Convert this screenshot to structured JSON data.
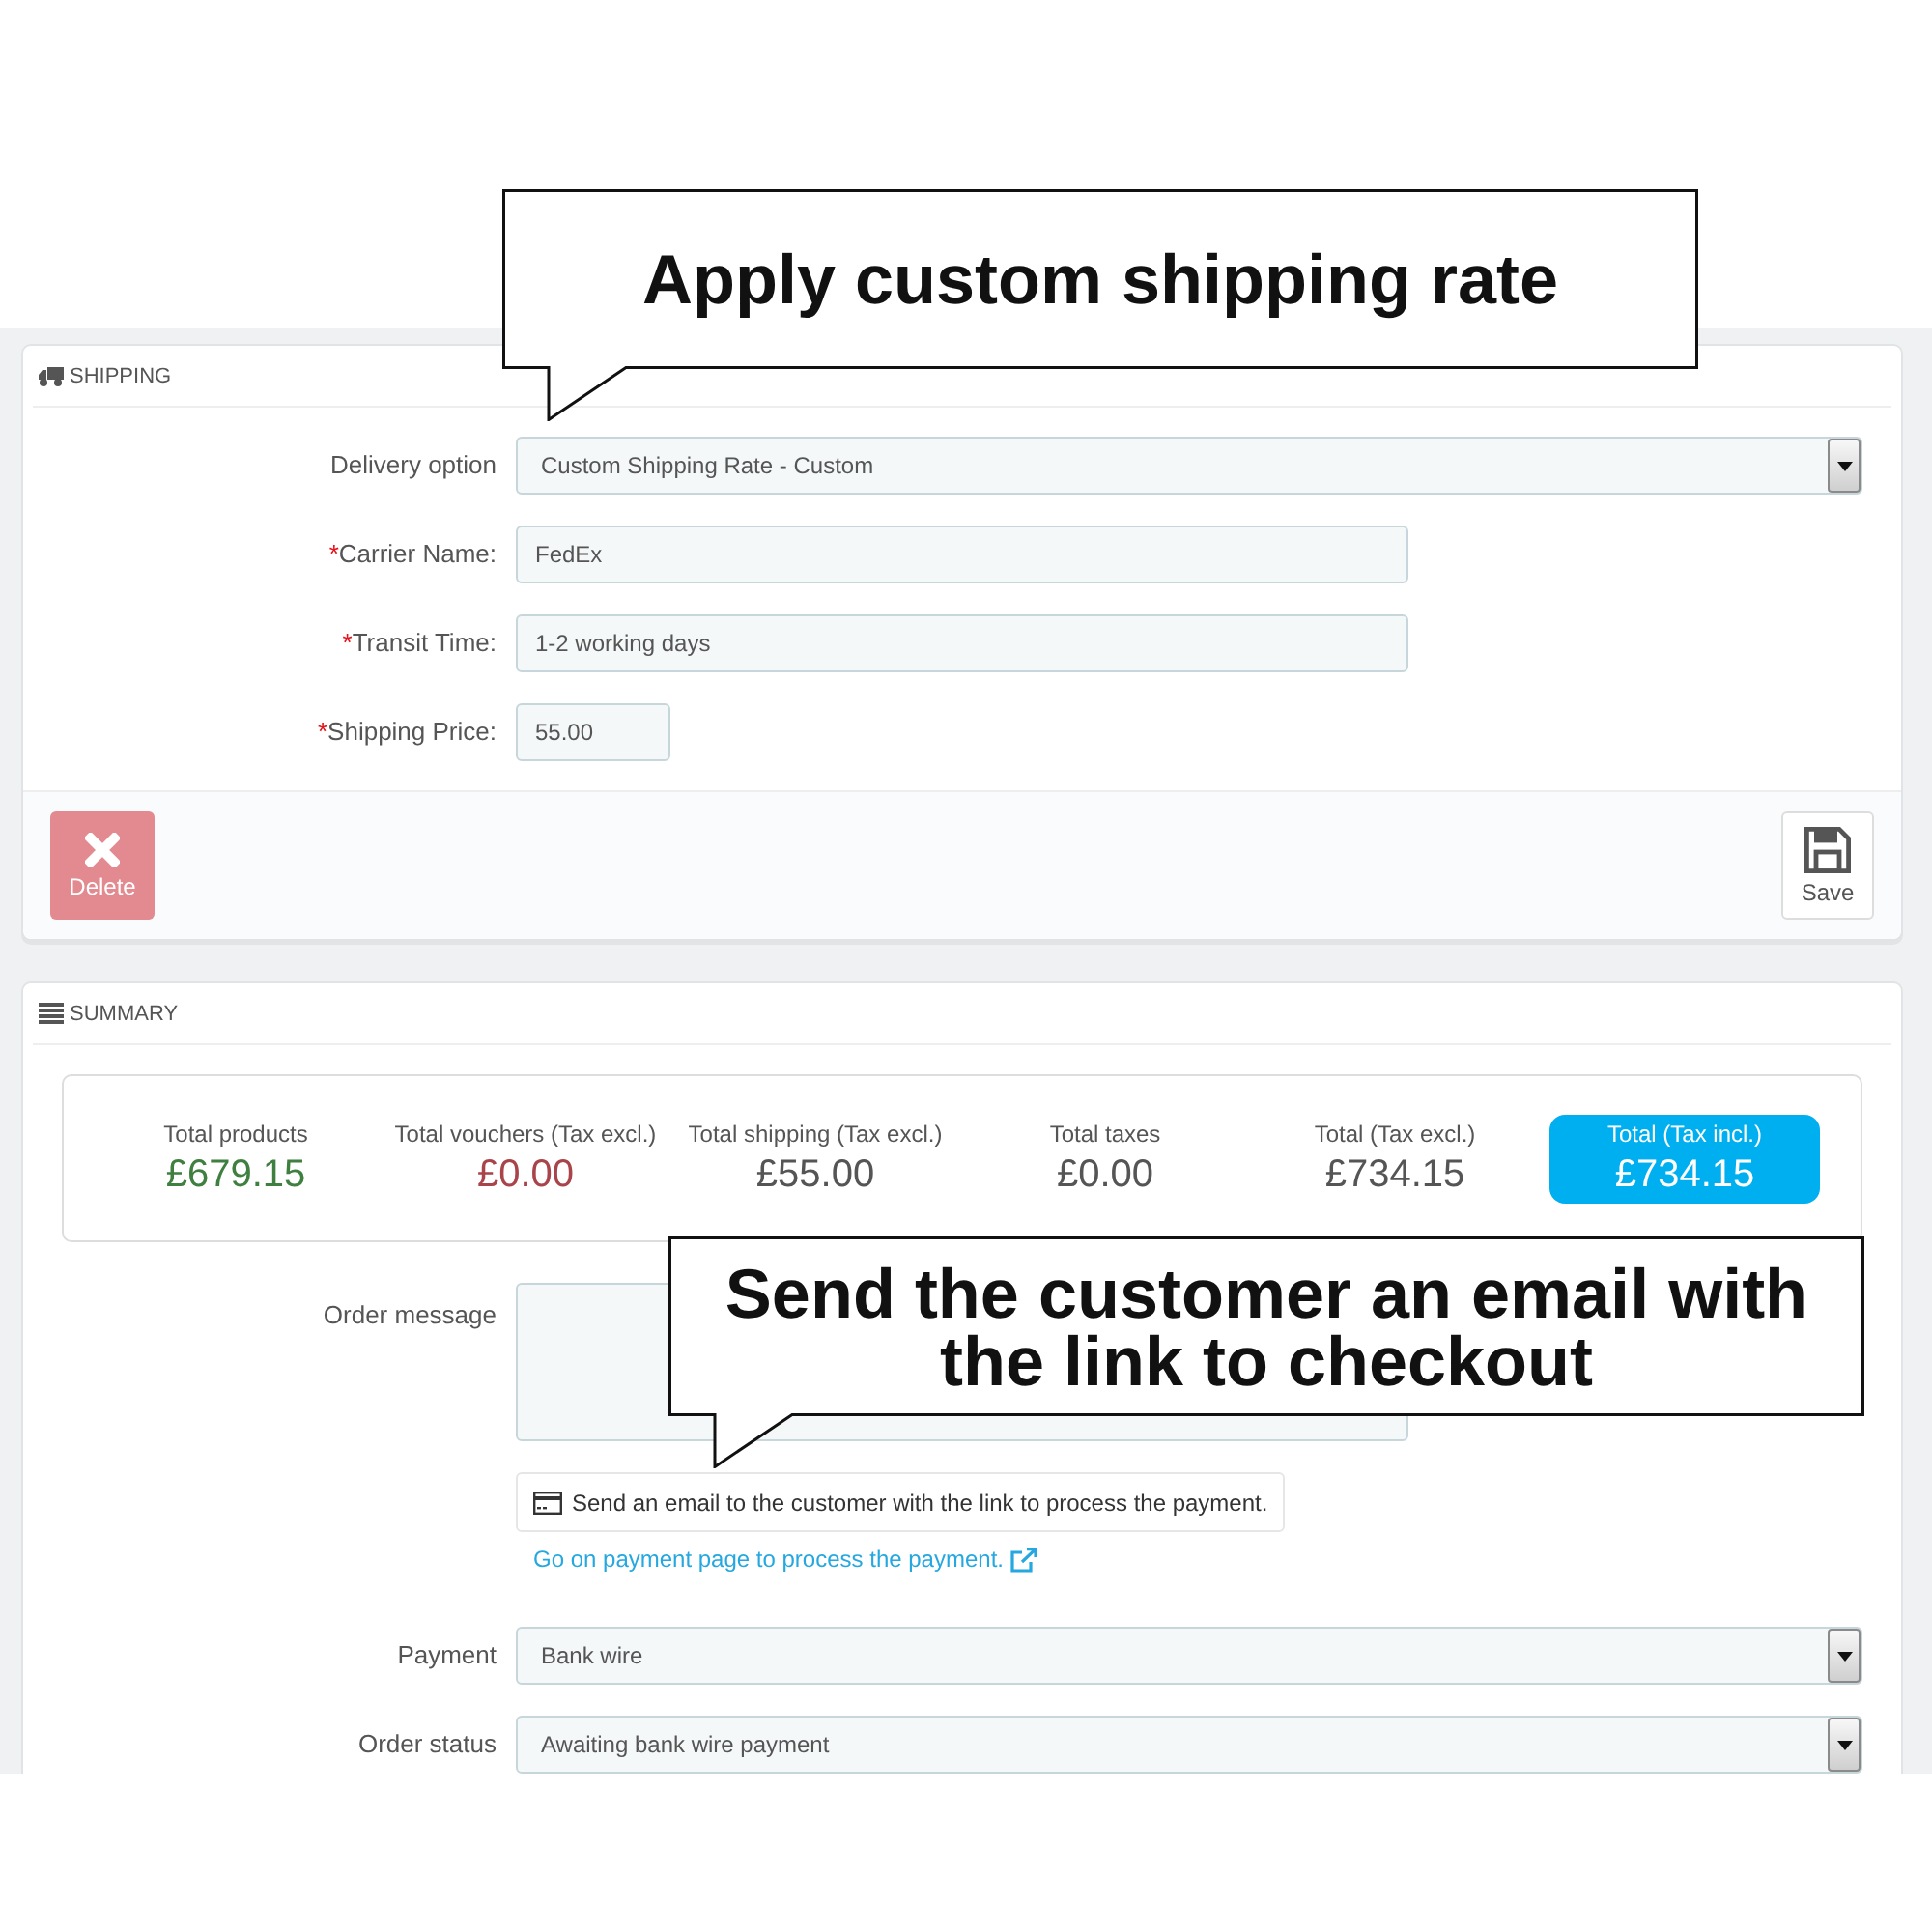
{
  "callouts": [
    {
      "text": "Apply custom shipping rate"
    },
    {
      "text": "Send the customer an email with the link to checkout"
    }
  ],
  "shipping": {
    "title": "SHIPPING",
    "fields": [
      {
        "kind": "select",
        "label": "Delivery option",
        "value": "Custom Shipping Rate - Custom"
      },
      {
        "kind": "text",
        "required_mark": "*",
        "label": "Carrier Name:",
        "value": "FedEx"
      },
      {
        "kind": "text",
        "required_mark": "*",
        "label": "Transit Time:",
        "value": "1-2 working days"
      },
      {
        "kind": "amount",
        "required_mark": "*",
        "label": "Shipping Price:",
        "value": "55.00"
      }
    ],
    "buttons": [
      {
        "kind": "delete",
        "label": "Delete"
      },
      {
        "kind": "save",
        "label": "Save"
      }
    ]
  },
  "summary": {
    "title": "SUMMARY",
    "totals": [
      {
        "kind": "plain",
        "label": "Total products",
        "value": "£679.15",
        "color": "#3f7f3f"
      },
      {
        "kind": "plain",
        "label": "Total vouchers (Tax excl.)",
        "value": "£0.00",
        "color": "#a9444a"
      },
      {
        "kind": "plain",
        "label": "Total shipping (Tax excl.)",
        "value": "£55.00",
        "color": "#555555"
      },
      {
        "kind": "plain",
        "label": "Total taxes",
        "value": "£0.00",
        "color": "#555555"
      },
      {
        "kind": "plain",
        "label": "Total (Tax excl.)",
        "value": "£734.15",
        "color": "#555555"
      },
      {
        "kind": "highlight",
        "label": "Total (Tax incl.)",
        "value": "£734.15",
        "color": "#00aff0"
      }
    ],
    "order_message": {
      "label": "Order message"
    },
    "send_email_button": {
      "label": "Send an email to the customer with the link to process the payment."
    },
    "payment_link": {
      "label": "Go on payment page to process the payment."
    },
    "fields": [
      {
        "kind": "select",
        "label": "Payment",
        "value": "Bank wire"
      },
      {
        "kind": "select",
        "label": "Order status",
        "value": "Awaiting bank wire payment"
      }
    ]
  }
}
